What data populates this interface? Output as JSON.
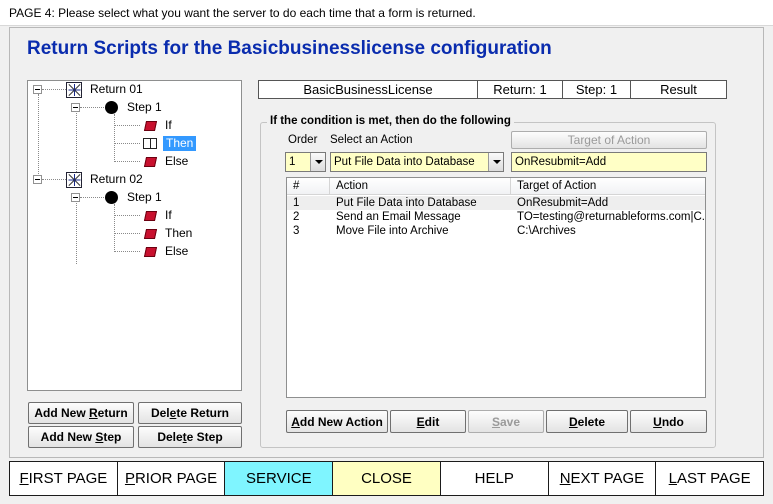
{
  "window": {
    "title": "PAGE 4: Please select what you want the server to do each time that a form is returned."
  },
  "heading": "Return Scripts for the Basicbusinesslicense configuration",
  "tree": {
    "return1": "Return 01",
    "step1a": "Step 1",
    "if1": "If",
    "then1": "Then",
    "else1": "Else",
    "return2": "Return 02",
    "step1b": "Step 1",
    "if2": "If",
    "then2": "Then",
    "else2": "Else"
  },
  "tree_buttons": {
    "add_return_pre": "Add New ",
    "add_return_u": "R",
    "add_return_post": "eturn",
    "delete_return_pre": "Del",
    "delete_return_u": "e",
    "delete_return_post": "te Return",
    "add_step_pre": "Add New ",
    "add_step_u": "S",
    "add_step_post": "tep",
    "delete_step_pre": "Dele",
    "delete_step_u": "t",
    "delete_step_post": "e Step"
  },
  "info": {
    "config": "BasicBusinessLicense",
    "return": "Return: 1",
    "step": "Step: 1",
    "result": "Result"
  },
  "group": {
    "legend": "If the condition is met, then do the following",
    "order_label": "Order",
    "action_label": "Select an Action",
    "target_button": "Target of Action",
    "order_value": "1",
    "action_value": "Put File Data into Database",
    "target_value": "OnResubmit=Add"
  },
  "list": {
    "columns": [
      "#",
      "Action",
      "Target of Action"
    ],
    "rows": [
      {
        "num": "1",
        "action": "Put File Data into Database",
        "target": "OnResubmit=Add"
      },
      {
        "num": "2",
        "action": "Send an Email Message",
        "target": "TO=testing@returnableforms.com|C..."
      },
      {
        "num": "3",
        "action": "Move File into Archive",
        "target": "C:\\Archives"
      }
    ]
  },
  "action_buttons": {
    "add_u": "A",
    "add_rest": "dd New Action",
    "edit_u": "E",
    "edit_rest": "dit",
    "save_u": "S",
    "save_rest": "ave",
    "delete_u": "D",
    "delete_rest": "elete",
    "undo_u": "U",
    "undo_rest": "ndo"
  },
  "nav": {
    "first_u": "F",
    "first_rest": "IRST PAGE",
    "prior_u": "P",
    "prior_rest": "RIOR PAGE",
    "service": "SERVICE",
    "close": "CLOSE",
    "help": "HELP",
    "next_u": "N",
    "next_rest": "EXT PAGE",
    "last_u": "L",
    "last_rest": "AST PAGE"
  },
  "colors": {
    "heading": "#0a2cae",
    "field_bg": "#ffffc6",
    "service_bg": "#7ff5ff",
    "close_bg": "#ffffc2",
    "selection": "#3399ff"
  }
}
